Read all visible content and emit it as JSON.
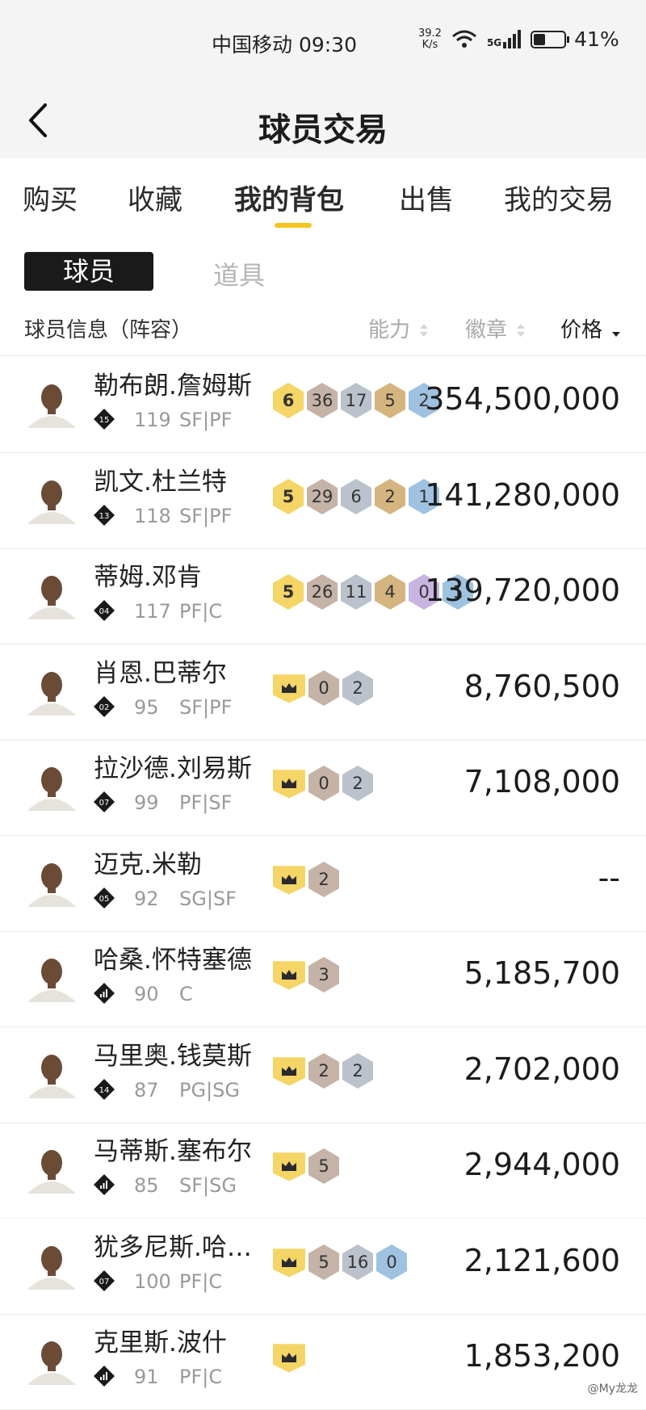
{
  "status_bar": {
    "carrier_time": "中国移动 09:30",
    "net_speed_value": "39.2",
    "net_speed_unit": "K/s",
    "network": "5G",
    "battery": "41%",
    "battery_level": 0.41
  },
  "header": {
    "title": "球员交易"
  },
  "tabs": [
    "购买",
    "收藏",
    "我的背包",
    "出售",
    "我的交易"
  ],
  "active_tab": "我的背包",
  "subtabs": {
    "active": "球员",
    "inactive": "道具"
  },
  "columns": {
    "info": "球员信息（阵容）",
    "ability": "能力",
    "badge": "徽章",
    "price": "价格"
  },
  "players": [
    {
      "name": "勒布朗.詹姆斯",
      "tier": "15",
      "rating": "119",
      "pos": "SF|PF",
      "badges": [
        {
          "v": "6",
          "t": "hof"
        },
        {
          "v": "36",
          "t": "bronze"
        },
        {
          "v": "17",
          "t": "silver"
        },
        {
          "v": "5",
          "t": "gold"
        },
        {
          "v": "2",
          "t": "blue"
        }
      ],
      "price": "354,500,000"
    },
    {
      "name": "凯文.杜兰特",
      "tier": "13",
      "rating": "118",
      "pos": "SF|PF",
      "badges": [
        {
          "v": "5",
          "t": "hof"
        },
        {
          "v": "29",
          "t": "bronze"
        },
        {
          "v": "6",
          "t": "silver"
        },
        {
          "v": "2",
          "t": "gold"
        },
        {
          "v": "1",
          "t": "blue"
        }
      ],
      "price": "141,280,000"
    },
    {
      "name": "蒂姆.邓肯",
      "tier": "04",
      "rating": "117",
      "pos": "PF|C",
      "badges": [
        {
          "v": "5",
          "t": "hof"
        },
        {
          "v": "26",
          "t": "bronze"
        },
        {
          "v": "11",
          "t": "silver"
        },
        {
          "v": "4",
          "t": "gold"
        },
        {
          "v": "0",
          "t": "purple"
        },
        {
          "v": "1",
          "t": "blue"
        }
      ],
      "price": "139,720,000"
    },
    {
      "name": "肖恩.巴蒂尔",
      "tier": "02",
      "rating": "95",
      "pos": "SF|PF",
      "badges": [
        {
          "v": "",
          "t": "crown"
        },
        {
          "v": "0",
          "t": "bronze"
        },
        {
          "v": "2",
          "t": "silver"
        }
      ],
      "price": "8,760,500"
    },
    {
      "name": "拉沙德.刘易斯",
      "tier": "07",
      "rating": "99",
      "pos": "PF|SF",
      "badges": [
        {
          "v": "",
          "t": "crown"
        },
        {
          "v": "0",
          "t": "bronze"
        },
        {
          "v": "2",
          "t": "silver"
        }
      ],
      "price": "7,108,000"
    },
    {
      "name": "迈克.米勒",
      "tier": "05",
      "rating": "92",
      "pos": "SG|SF",
      "badges": [
        {
          "v": "",
          "t": "crown"
        },
        {
          "v": "2",
          "t": "bronze"
        }
      ],
      "price": "--"
    },
    {
      "name": "哈桑.怀特塞德",
      "tier": "",
      "rating": "90",
      "pos": "C",
      "badges": [
        {
          "v": "",
          "t": "crown"
        },
        {
          "v": "3",
          "t": "bronze"
        }
      ],
      "price": "5,185,700"
    },
    {
      "name": "马里奥.钱莫斯",
      "tier": "14",
      "rating": "87",
      "pos": "PG|SG",
      "badges": [
        {
          "v": "",
          "t": "crown"
        },
        {
          "v": "2",
          "t": "bronze"
        },
        {
          "v": "2",
          "t": "silver"
        }
      ],
      "price": "2,702,000"
    },
    {
      "name": "马蒂斯.塞布尔",
      "tier": "",
      "rating": "85",
      "pos": "SF|SG",
      "badges": [
        {
          "v": "",
          "t": "crown"
        },
        {
          "v": "5",
          "t": "bronze"
        }
      ],
      "price": "2,944,000"
    },
    {
      "name": "犹多尼斯.哈…",
      "tier": "07",
      "rating": "100",
      "pos": "PF|C",
      "badges": [
        {
          "v": "",
          "t": "crown"
        },
        {
          "v": "5",
          "t": "bronze"
        },
        {
          "v": "16",
          "t": "silver"
        },
        {
          "v": "0",
          "t": "blue"
        }
      ],
      "price": "2,121,600"
    },
    {
      "name": "克里斯.波什",
      "tier": "",
      "rating": "91",
      "pos": "PF|C",
      "badges": [
        {
          "v": "",
          "t": "crown"
        }
      ],
      "price": "1,853,200"
    }
  ],
  "watermark": "@My龙龙",
  "colors": {
    "accent": "#f7c31e",
    "background": "#f4f4f4",
    "subtab_active_bg": "#1a1a1a"
  }
}
